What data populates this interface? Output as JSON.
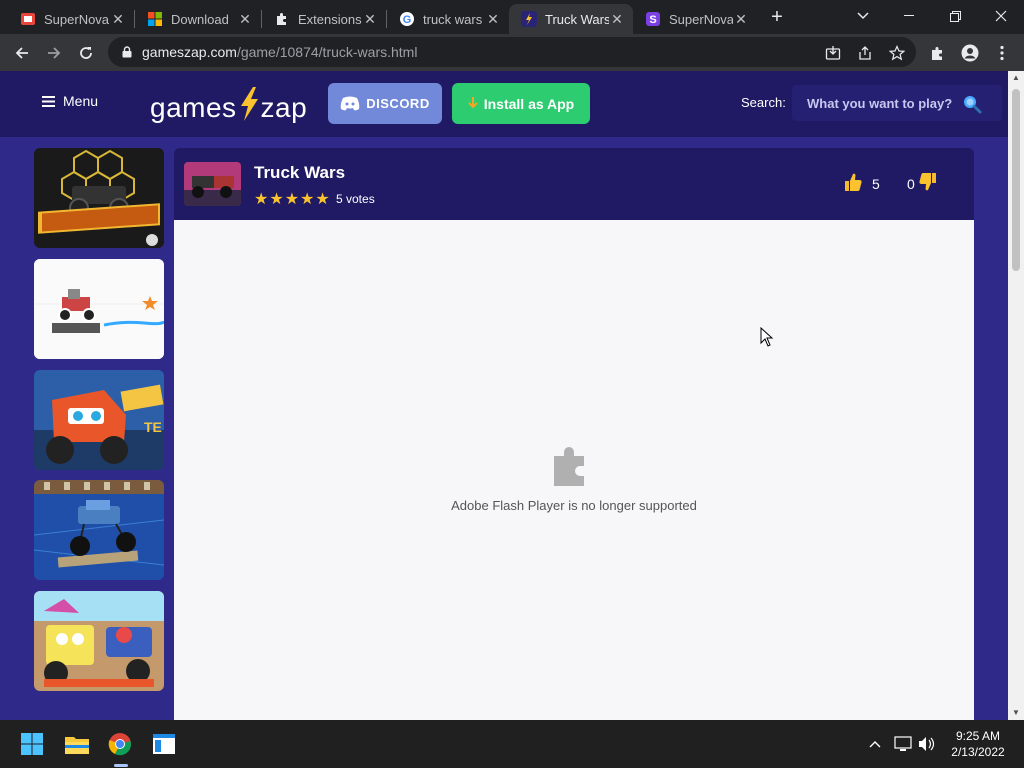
{
  "browser": {
    "tabs": [
      {
        "label": "SuperNova",
        "icon": "supernova-favicon"
      },
      {
        "label": "Download",
        "icon": "windows-favicon"
      },
      {
        "label": "Extensions",
        "icon": "puzzle-favicon"
      },
      {
        "label": "truck wars",
        "icon": "google-favicon"
      },
      {
        "label": "Truck Wars",
        "icon": "gameszap-favicon",
        "active": true
      },
      {
        "label": "SuperNova",
        "icon": "supernova-s-favicon"
      }
    ],
    "url_host": "gameszap.com",
    "url_path": "/game/10874/truck-wars.html"
  },
  "site": {
    "menu_label": "Menu",
    "logo_left": "games",
    "logo_right": "zap",
    "discord_label": "DISCORD",
    "install_label": "Install as App",
    "search_label": "Search:",
    "search_placeholder": "What you want to play?"
  },
  "game": {
    "title": "Truck Wars",
    "stars": "★★★★★",
    "votes_label": "5 votes",
    "likes": "5",
    "dislikes": "0",
    "flash_message": "Adobe Flash Player is no longer supported"
  },
  "taskbar": {
    "time": "9:25 AM",
    "date": "2/13/2022"
  },
  "colors": {
    "page_bg": "#2f2a8a",
    "header_bg": "#1f1a63",
    "discord": "#7289da",
    "install": "#2ecc71",
    "star": "#f9c22e"
  }
}
